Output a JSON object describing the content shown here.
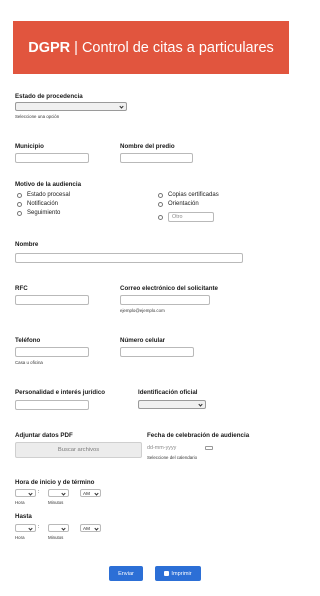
{
  "header": {
    "brand": "DGPR",
    "separator": " | ",
    "title": "Control de citas a particulares"
  },
  "estado": {
    "label": "Estado de procedencia",
    "value": "",
    "hint": "Seleccione una opción"
  },
  "municipio": {
    "label": "Municipio",
    "value": ""
  },
  "predio": {
    "label": "Nombre del predio",
    "value": ""
  },
  "motivo": {
    "label": "Motivo de la audiencia",
    "options_left": [
      "Estado procesal",
      "Notificación",
      "Seguimiento"
    ],
    "options_right": [
      "Copias certificadas",
      "Orientación"
    ],
    "other_placeholder": "Otro"
  },
  "nombre": {
    "label": "Nombre",
    "value": ""
  },
  "rfc": {
    "label": "RFC",
    "value": ""
  },
  "correo": {
    "label": "Correo electrónico del solicitante",
    "value": "",
    "hint": "ejemplo@ejemplo.com"
  },
  "telefono": {
    "label": "Teléfono",
    "value": "",
    "hint": "Casa u oficina"
  },
  "celular": {
    "label": "Número celular",
    "value": ""
  },
  "personalidad": {
    "label": "Personalidad e interés jurídico",
    "value": ""
  },
  "identificacion": {
    "label": "Identificación oficial",
    "value": ""
  },
  "adjuntar": {
    "label": "Adjuntar datos PDF",
    "button": "Buscar archivos"
  },
  "fecha": {
    "label": "Fecha de celebración de audiencia",
    "placeholder": "dd-mm-yyyy",
    "hint": "Seleccione del calendario"
  },
  "hora": {
    "label": "Hora de inicio y de término",
    "hasta_label": "Hasta",
    "hour_label": "Hora",
    "min_label": "Minutos",
    "colon": ":",
    "ampm": "AM"
  },
  "actions": {
    "submit": "Enviar",
    "print": "Imprimir"
  },
  "colors": {
    "header": "#e1553e",
    "button": "#2c6fd6"
  }
}
